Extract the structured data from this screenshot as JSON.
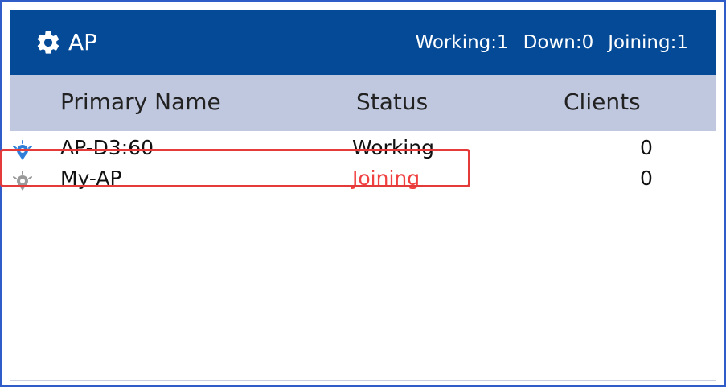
{
  "panel": {
    "title": "AP",
    "title_icon": "gear-icon",
    "counts": {
      "working": "Working:1",
      "down": "Down:0",
      "joining": "Joining:1"
    }
  },
  "table": {
    "columns": [
      "Primary Name",
      "Status",
      "Clients"
    ],
    "rows": [
      {
        "icon": "ap-online-icon",
        "name": "AP-D3:60",
        "status": "Working",
        "clients": "0",
        "status_color": "#111111"
      },
      {
        "icon": "ap-offline-icon",
        "name": "My-AP",
        "status": "Joining",
        "clients": "0",
        "status_color": "#f04040"
      }
    ]
  },
  "colors": {
    "header_bg": "#054a97",
    "column_header_bg": "#c0c8df",
    "joining_text": "#f04040",
    "highlight_border": "#e53a3a",
    "online_icon": "#2f7fd8",
    "offline_icon": "#9a9a9a"
  }
}
